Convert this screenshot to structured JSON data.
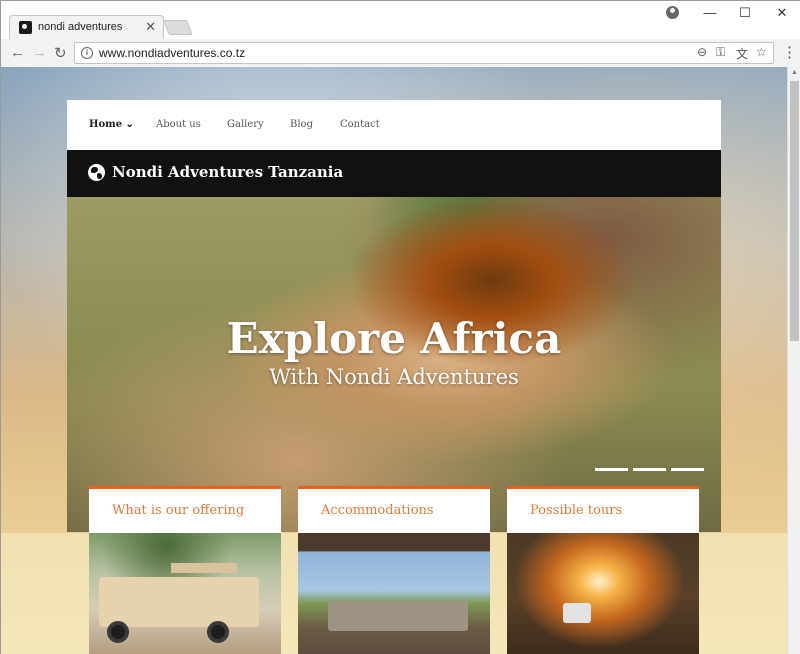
{
  "browser": {
    "tab_title": "nondi adventures",
    "tab_close": "✕",
    "url": "www.nondiadventures.co.tz",
    "window_controls": {
      "minimize": "—",
      "maximize": "☐",
      "close": "✕"
    },
    "nav": {
      "back": "←",
      "forward": "→",
      "reload": "↻"
    },
    "omnibox_icons": [
      "zoom-icon",
      "key-icon",
      "translate-icon",
      "star-icon"
    ],
    "menu": "⋮"
  },
  "site": {
    "nav": [
      {
        "label": "Home ⌄",
        "active": true
      },
      {
        "label": "About us"
      },
      {
        "label": "Gallery"
      },
      {
        "label": "Blog"
      },
      {
        "label": "Contact"
      }
    ],
    "brand": "Nondi Adventures Tanzania",
    "hero": {
      "title": "Explore Africa",
      "subtitle": "With Nondi Adventures"
    },
    "cards": [
      {
        "title": "What is our offering"
      },
      {
        "title": "Accommodations"
      },
      {
        "title": "Possible tours"
      }
    ],
    "colors": {
      "accent": "#e8601c",
      "brandbar": "#111111"
    }
  }
}
